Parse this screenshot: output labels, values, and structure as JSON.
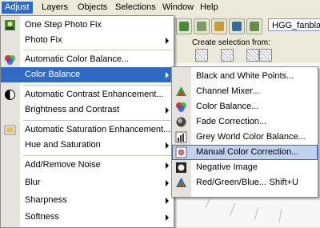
{
  "menubar": [
    "Adjust",
    "Layers",
    "Objects",
    "Selections",
    "Window",
    "Help"
  ],
  "toolbar": {
    "filename": "HGG_fanblade",
    "create_selection_label": "Create selection from:"
  },
  "adjust_menu": [
    {
      "label": "One Step Photo Fix",
      "icon": "one-step-fix-icon"
    },
    {
      "label": "Photo Fix",
      "submenu": true
    },
    {
      "label": "Automatic Color Balance...",
      "icon": "color-balance-icon"
    },
    {
      "label": "Color Balance",
      "submenu": true,
      "highlighted": true
    },
    {
      "label": "Automatic Contrast Enhancement...",
      "icon": "contrast-icon"
    },
    {
      "label": "Brightness and Contrast",
      "submenu": true
    },
    {
      "label": "Automatic Saturation Enhancement...",
      "icon": "saturation-icon"
    },
    {
      "label": "Hue and Saturation",
      "submenu": true
    },
    {
      "label": "Add/Remove Noise",
      "submenu": true
    },
    {
      "label": "Blur",
      "submenu": true
    },
    {
      "label": "Sharpness",
      "submenu": true
    },
    {
      "label": "Softness",
      "submenu": true
    }
  ],
  "color_balance_menu": [
    {
      "label": "Black and White Points..."
    },
    {
      "label": "Channel Mixer...",
      "icon": "channel-mixer-icon"
    },
    {
      "label": "Color Balance...",
      "icon": "color-balance-icon"
    },
    {
      "label": "Fade Correction...",
      "icon": "fade-correction-icon"
    },
    {
      "label": "Grey World Color Balance...",
      "icon": "grey-world-icon"
    },
    {
      "label": "Manual Color Correction...",
      "icon": "manual-color-icon",
      "highlighted": true
    },
    {
      "label": "Negative Image",
      "icon": "negative-image-icon"
    },
    {
      "label": "Red/Green/Blue...",
      "icon": "rgb-icon",
      "shortcut": "Shift+U"
    }
  ]
}
